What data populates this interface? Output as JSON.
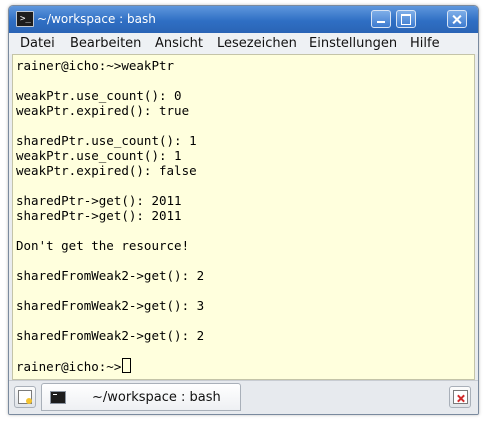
{
  "window": {
    "title": "~/workspace : bash"
  },
  "menu": {
    "items": [
      "Datei",
      "Bearbeiten",
      "Ansicht",
      "Lesezeichen",
      "Einstellungen",
      "Hilfe"
    ]
  },
  "terminal": {
    "lines": [
      "rainer@icho:~>weakPtr",
      "",
      "weakPtr.use_count(): 0",
      "weakPtr.expired(): true",
      "",
      "sharedPtr.use_count(): 1",
      "weakPtr.use_count(): 1",
      "weakPtr.expired(): false",
      "",
      "sharedPtr->get(): 2011",
      "sharedPtr->get(): 2011",
      "",
      "Don't get the resource!",
      "",
      "sharedFromWeak2->get(): 2",
      "",
      "sharedFromWeak2->get(): 3",
      "",
      "sharedFromWeak2->get(): 2",
      "",
      "rainer@icho:~>"
    ]
  },
  "tabs": [
    {
      "label": "~/workspace : bash"
    }
  ],
  "icons": {
    "app": "terminal-icon",
    "new_tab": "new-tab-icon",
    "close_tab": "close-tab-icon"
  },
  "colors": {
    "titlebar": "#2f6fc4",
    "terminal_background": "#ffffdd"
  }
}
